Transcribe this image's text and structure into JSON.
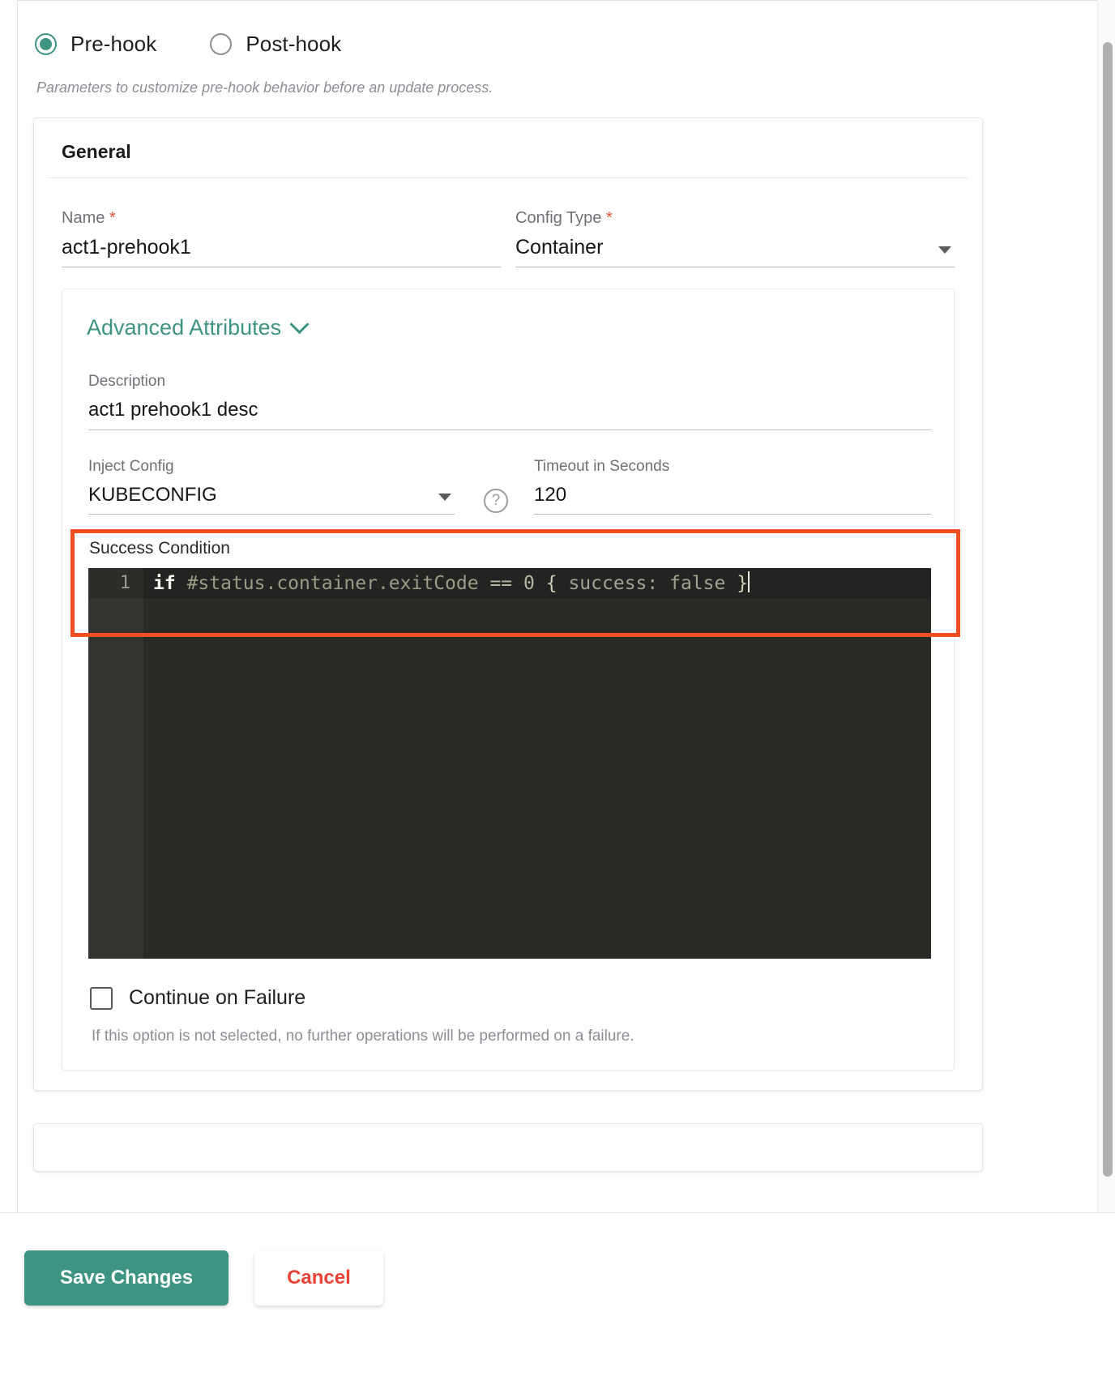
{
  "hook_type": {
    "options": [
      {
        "label": "Pre-hook",
        "selected": true
      },
      {
        "label": "Post-hook",
        "selected": false
      }
    ],
    "description": "Parameters to customize pre-hook behavior before an update process."
  },
  "general": {
    "section_title": "General",
    "name": {
      "label": "Name",
      "required_mark": "*",
      "value": "act1-prehook1"
    },
    "config_type": {
      "label": "Config Type",
      "required_mark": "*",
      "value": "Container"
    }
  },
  "advanced": {
    "title": "Advanced Attributes",
    "chevron_icon": "chevron-down-icon",
    "description": {
      "label": "Description",
      "value": "act1 prehook1 desc"
    },
    "inject_config": {
      "label": "Inject Config",
      "value": "KUBECONFIG"
    },
    "help_icon": "help-circle-icon",
    "help_glyph": "?",
    "timeout": {
      "label": "Timeout in Seconds",
      "value": "120"
    },
    "success_condition": {
      "label": "Success Condition",
      "line_number": "1",
      "tokens": {
        "keyword": "if",
        "reference": "#status.container.exitCode",
        "operator": "==",
        "number": "0",
        "brace_open": "{",
        "property": "success:",
        "boolean": "false",
        "brace_close": "}"
      },
      "full_text": "if #status.container.exitCode == 0 { success: false }"
    },
    "continue_on_failure": {
      "label": "Continue on Failure",
      "checked": false,
      "hint": "If this option is not selected, no further operations will be performed on a failure."
    }
  },
  "footer": {
    "save_label": "Save Changes",
    "cancel_label": "Cancel"
  },
  "colors": {
    "accent_teal": "#3d9482",
    "required_red": "#e8503a",
    "cancel_red": "#ea4335",
    "highlight_orange": "#f04e23",
    "editor_bg": "#282a26"
  }
}
